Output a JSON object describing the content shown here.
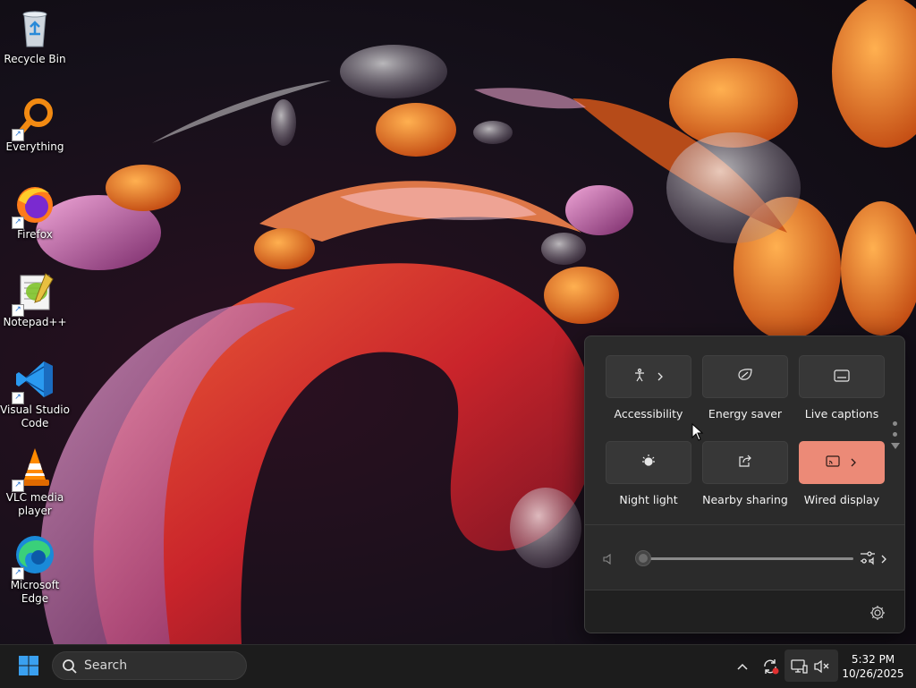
{
  "desktop": {
    "icons": [
      {
        "label": "Recycle Bin",
        "icon": "recycle-bin-icon"
      },
      {
        "label": "Everything",
        "icon": "everything-search-icon"
      },
      {
        "label": "Firefox",
        "icon": "firefox-icon"
      },
      {
        "label": "Notepad++",
        "icon": "notepad-plus-plus-icon"
      },
      {
        "label": "Visual Studio Code",
        "icon": "vscode-icon"
      },
      {
        "label": "VLC media player",
        "icon": "vlc-icon"
      },
      {
        "label": "Microsoft Edge",
        "icon": "edge-icon"
      }
    ]
  },
  "quick_settings": {
    "tiles": [
      {
        "label": "Accessibility",
        "icon": "accessibility-icon",
        "has_chevron": true,
        "active": false
      },
      {
        "label": "Energy saver",
        "icon": "leaf-icon",
        "has_chevron": false,
        "active": false
      },
      {
        "label": "Live captions",
        "icon": "captions-icon",
        "has_chevron": false,
        "active": false
      },
      {
        "label": "Night light",
        "icon": "night-light-icon",
        "has_chevron": false,
        "active": false
      },
      {
        "label": "Nearby sharing",
        "icon": "share-icon",
        "has_chevron": false,
        "active": false
      },
      {
        "label": "Wired display",
        "icon": "cast-icon",
        "has_chevron": true,
        "active": true
      }
    ],
    "volume": {
      "level": 0,
      "muted": true
    },
    "accent_color": "#ec8a77"
  },
  "taskbar": {
    "search_placeholder": "Search",
    "clock": {
      "time": "5:32 PM",
      "date": "10/26/2025"
    }
  }
}
